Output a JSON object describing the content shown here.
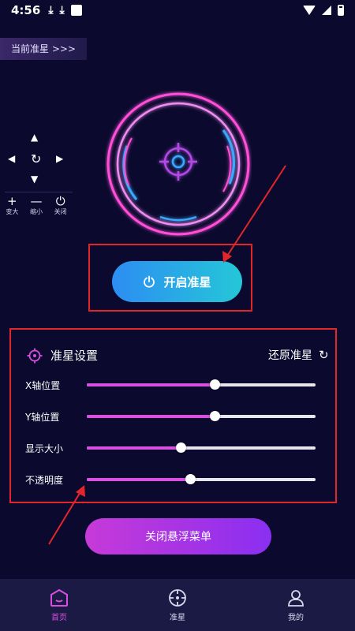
{
  "status": {
    "time": "4:56",
    "icons": [
      "download-icon",
      "download-icon",
      "notification-icon",
      "wifi-icon",
      "signal-icon",
      "battery-icon"
    ]
  },
  "tag": {
    "label": "当前准星 >>>"
  },
  "controls": [
    {
      "glyph": "+",
      "label": "变大"
    },
    {
      "glyph": "—",
      "label": "缩小"
    },
    {
      "glyph": "⏻",
      "label": "关闭"
    }
  ],
  "start_button": {
    "label": "开启准星"
  },
  "settings": {
    "title": "准星设置",
    "reset_label": "还原准星",
    "sliders": [
      {
        "label": "X轴位置",
        "value": 0.56
      },
      {
        "label": "Y轴位置",
        "value": 0.56
      },
      {
        "label": "显示大小",
        "value": 0.41
      },
      {
        "label": "不透明度",
        "value": 0.45
      }
    ]
  },
  "close_button": {
    "label": "关闭悬浮菜单"
  },
  "nav": [
    {
      "label": "首页",
      "icon": "home-icon",
      "active": true
    },
    {
      "label": "准星",
      "icon": "crosshair-icon",
      "active": false
    },
    {
      "label": "我的",
      "icon": "user-icon",
      "active": false
    }
  ],
  "colors": {
    "background": "#0b0a2e",
    "accent": "#d74ee0",
    "ring_pink": "#ff4fd8",
    "ring_blue": "#3aa8ff",
    "highlight_red": "#e3262a"
  }
}
